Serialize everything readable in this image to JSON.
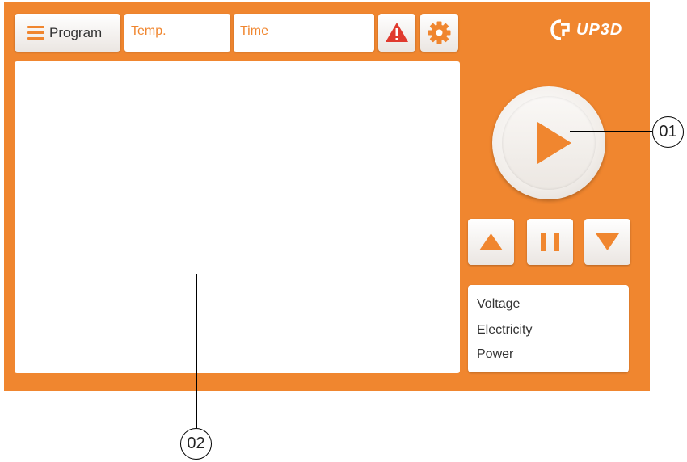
{
  "toolbar": {
    "program_label": "Program",
    "temp_placeholder": "Temp.",
    "time_placeholder": "Time",
    "menu_icon": "hamburger-menu-icon",
    "warning_icon": "warning-triangle-icon",
    "settings_icon": "gear-icon"
  },
  "brand": {
    "name": "UP3D"
  },
  "controls": {
    "play_icon": "play-icon",
    "up_icon": "arrow-up-icon",
    "pause_icon": "pause-icon",
    "down_icon": "arrow-down-icon"
  },
  "info_panel": {
    "voltage_label": "Voltage",
    "electricity_label": "Electricity",
    "power_label": "Power"
  },
  "callouts": {
    "one": "01",
    "two": "02"
  },
  "colors": {
    "accent": "#f0862f",
    "warning": "#e03a2e",
    "panel_bg": "#ffffff"
  }
}
